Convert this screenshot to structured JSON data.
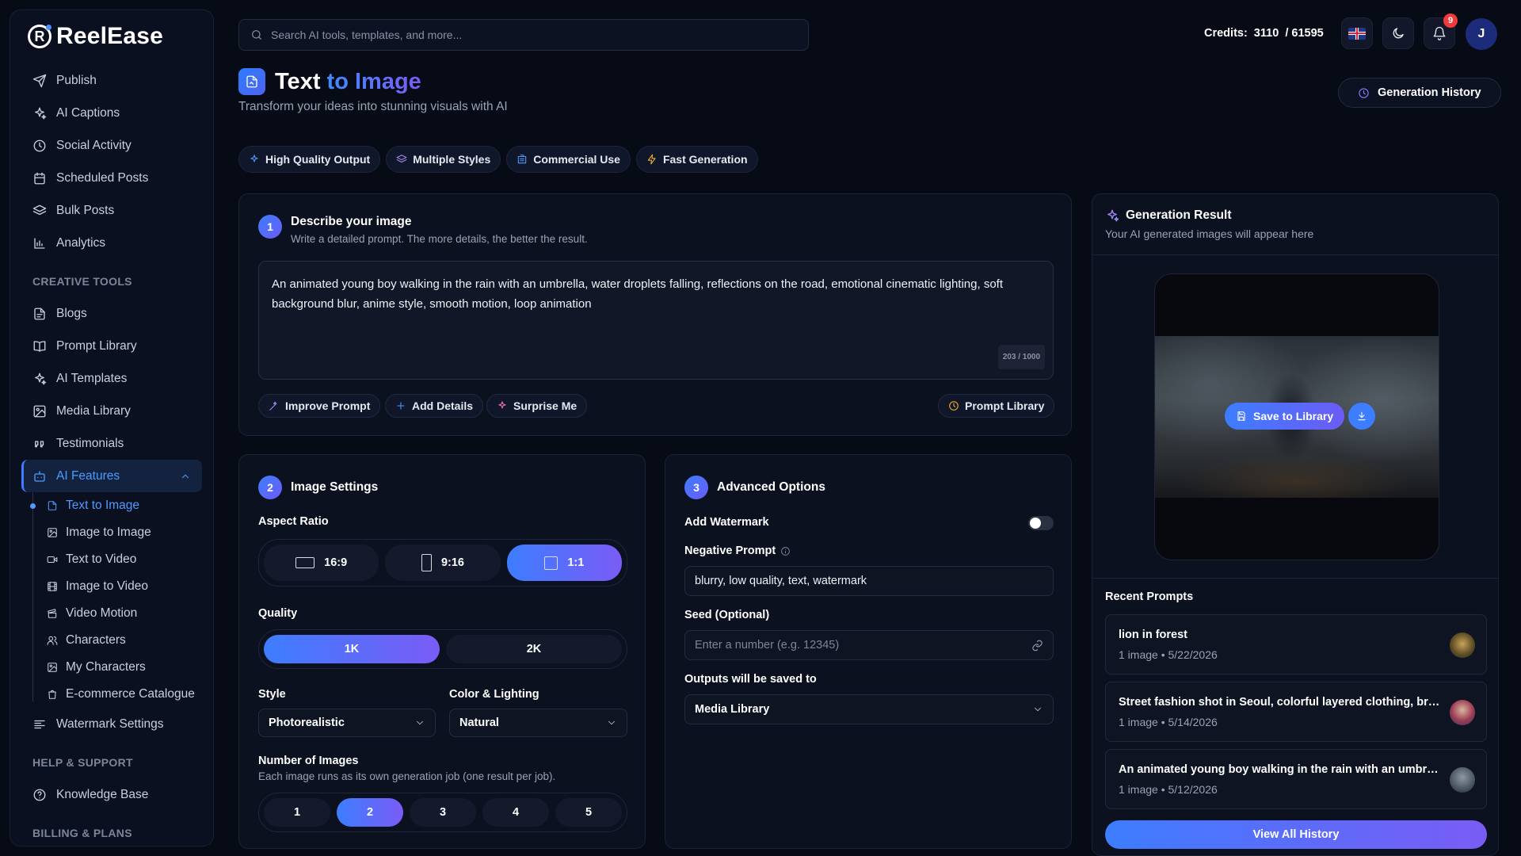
{
  "app": {
    "name": "ReelEase"
  },
  "sidebar": {
    "items": [
      {
        "label": "Publish",
        "icon": "send-icon"
      },
      {
        "label": "AI Captions",
        "icon": "sparkles-icon"
      },
      {
        "label": "Social Activity",
        "icon": "clock-icon"
      },
      {
        "label": "Scheduled Posts",
        "icon": "calendar-icon"
      },
      {
        "label": "Bulk Posts",
        "icon": "layers-icon"
      },
      {
        "label": "Analytics",
        "icon": "bar-chart-icon"
      }
    ],
    "section_creative": "CREATIVE TOOLS",
    "creative_items": [
      {
        "label": "Blogs",
        "icon": "document-icon"
      },
      {
        "label": "Prompt Library",
        "icon": "book-icon"
      },
      {
        "label": "AI Templates",
        "icon": "sparkles-icon"
      },
      {
        "label": "Media Library",
        "icon": "image-icon"
      },
      {
        "label": "Testimonials",
        "icon": "quote-icon"
      }
    ],
    "ai_features": {
      "label": "AI Features",
      "icon": "robot-icon"
    },
    "ai_sub": [
      {
        "label": "Text to Image",
        "icon": "file-image-icon"
      },
      {
        "label": "Image to Image",
        "icon": "image-icon"
      },
      {
        "label": "Text to Video",
        "icon": "video-icon"
      },
      {
        "label": "Image to Video",
        "icon": "film-icon"
      },
      {
        "label": "Video Motion",
        "icon": "clapper-icon"
      },
      {
        "label": "Characters",
        "icon": "users-icon"
      },
      {
        "label": "My Characters",
        "icon": "image-icon"
      },
      {
        "label": "E-commerce Catalogue",
        "icon": "shopping-bag-icon"
      }
    ],
    "watermark": {
      "label": "Watermark Settings",
      "icon": "text-align-icon"
    },
    "section_help": "HELP & SUPPORT",
    "knowledge": {
      "label": "Knowledge Base",
      "icon": "help-circle-icon"
    },
    "section_billing": "BILLING & PLANS"
  },
  "topbar": {
    "search_placeholder": "Search AI tools, templates, and more...",
    "credits_label": "Credits:",
    "credits_used": "3110",
    "credits_total": "/ 61595",
    "notifications": "9",
    "avatar": "J"
  },
  "header": {
    "title_main": "Text",
    "title_accent": "to Image",
    "subtitle": "Transform your ideas into stunning visuals with AI",
    "history_button": "Generation History"
  },
  "features": [
    "High Quality Output",
    "Multiple Styles",
    "Commercial Use",
    "Fast Generation"
  ],
  "step1": {
    "num": "1",
    "title": "Describe your image",
    "subtitle": "Write a detailed prompt. The more details, the better the result.",
    "prompt": "An animated young boy walking in the rain with an umbrella, water droplets falling, reflections on the road, emotional cinematic lighting, soft background blur, anime style, smooth motion, loop animation",
    "counter": "203 / 1000",
    "improve": "Improve Prompt",
    "add_details": "Add Details",
    "surprise": "Surprise Me",
    "library": "Prompt Library"
  },
  "step2": {
    "num": "2",
    "title": "Image Settings",
    "aspect_label": "Aspect Ratio",
    "aspects": [
      "16:9",
      "9:16",
      "1:1"
    ],
    "quality_label": "Quality",
    "qualities": [
      "1K",
      "2K"
    ],
    "style_label": "Style",
    "style_value": "Photorealistic",
    "color_label": "Color & Lighting",
    "color_value": "Natural",
    "num_label": "Number of Images",
    "num_sub": "Each image runs as its own generation job (one result per job).",
    "nums": [
      "1",
      "2",
      "3",
      "4",
      "5"
    ]
  },
  "step3": {
    "num": "3",
    "title": "Advanced Options",
    "watermark_label": "Add Watermark",
    "negative_label": "Negative Prompt",
    "negative_value": "blurry, low quality, text, watermark",
    "seed_label": "Seed (Optional)",
    "seed_placeholder": "Enter a number (e.g. 12345)",
    "save_label": "Outputs will be saved to",
    "save_value": "Media Library"
  },
  "result": {
    "title": "Generation Result",
    "subtitle": "Your AI generated images will appear here",
    "save_button": "Save to Library",
    "recent_title": "Recent Prompts",
    "recent": [
      {
        "title": "lion in forest",
        "meta": "1 image • 5/22/2026"
      },
      {
        "title": "Street fashion shot in Seoul, colorful layered clothing, bright",
        "meta": "1 image • 5/14/2026"
      },
      {
        "title": "An animated young boy walking in the rain with an umbrella",
        "meta": "1 image • 5/12/2026"
      }
    ],
    "view_all": "View All History"
  }
}
